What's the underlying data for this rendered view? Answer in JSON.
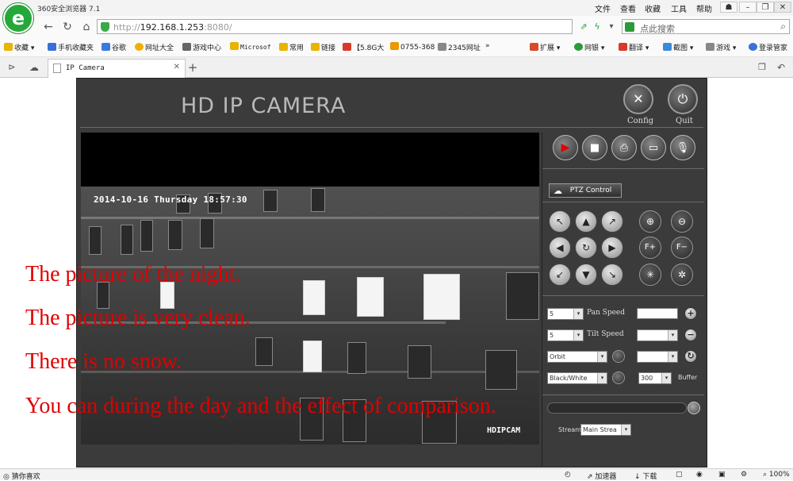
{
  "browser": {
    "app_title": "360安全浏览器 7.1",
    "menu": [
      "文件",
      "查看",
      "收藏",
      "工具",
      "帮助"
    ],
    "url_host": "192.168.1.253",
    "url_port": ":8080/",
    "url_scheme": "http://",
    "search_placeholder": "点此搜索",
    "bookmarks": [
      {
        "label": "收藏",
        "color": "#e8b400"
      },
      {
        "label": "手机收藏夹",
        "color": "#3a6fd8"
      },
      {
        "label": "谷歌",
        "color": "#3a7ae0"
      },
      {
        "label": "网址大全",
        "color": "#f0b000"
      },
      {
        "label": "游戏中心",
        "color": "#666666"
      },
      {
        "label": "Microsof",
        "color": "#e8b400"
      },
      {
        "label": "常用",
        "color": "#e8b400"
      },
      {
        "label": "链接",
        "color": "#e8b400"
      },
      {
        "label": "【5.8G大",
        "color": "#d83a2a"
      },
      {
        "label": "0755-368",
        "color": "#e89a00"
      },
      {
        "label": "2345网址",
        "color": "#888888"
      }
    ],
    "toolbar_right": [
      "扩展",
      "网银",
      "翻译",
      "截图",
      "游戏",
      "登录管家"
    ],
    "tab_label": "IP Camera",
    "status_left": "猜你喜欢",
    "status_right": [
      "加速器",
      "下载",
      "100%"
    ]
  },
  "camera": {
    "title": "HD IP CAMERA",
    "config_label": "Config",
    "quit_label": "Quit",
    "osd_time": "2014-10-16 Thursday 18:57:30",
    "osd_name": "HDIPCAM",
    "ptz_label": "PTZ Control",
    "pan_value": "5",
    "pan_label": "Pan Speed",
    "tilt_value": "5",
    "tilt_label": "Tilt Speed",
    "orbit_value": "Orbit",
    "color_value": "Black/White",
    "buffer_value": "300",
    "buffer_label": "Buffer",
    "stream_label": "Stream",
    "stream_value": "Main Strea"
  },
  "overlay_lines": [
    "The picture of the night.",
    "The picture is very clean.",
    "There is no snow.",
    "You can during the day and the effect of comparison."
  ],
  "colors": {
    "overlay_text": "#e10000",
    "panel_bg": "#3b3b3b",
    "record_icon": "#e00000"
  }
}
